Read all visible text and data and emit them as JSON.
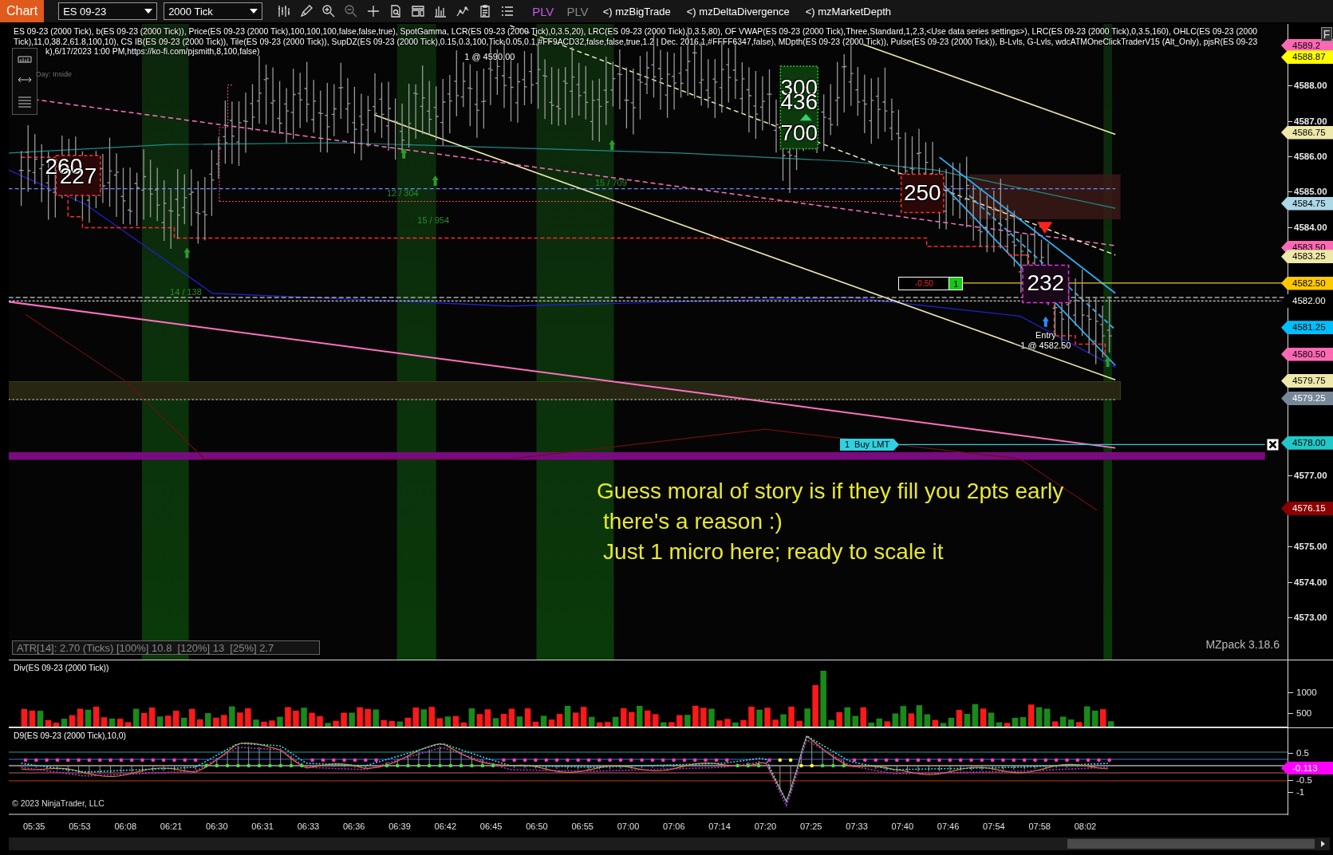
{
  "toolbar": {
    "title": "Chart",
    "instrument": "ES 09-23",
    "period": "2000 Tick",
    "buttons": [
      {
        "label": "PLV",
        "on": true
      },
      {
        "label": "PLV",
        "on": false
      }
    ],
    "indicators": [
      "<) mzBigTrade",
      "<) mzDeltaDivergence",
      "<) mzMarketDepth"
    ]
  },
  "legend": [
    "ES 09-23 (2000 Tick), b(ES 09-23 (2000 Tick)), Price(ES 09-23 (2000 Tick),100,100,100,false,false,true), SpotGamma, LCR(ES 09-23 (2000 Tick),0,3.5,20), LRC(ES 09-23 (2000 Tick),0,3.5,80), OF VWAP(ES 09-23 (2000 Tick),Three,Standard,1,2,3,<Use data series settings>), LRC(ES 09-23 (2000 Tick),0,3.5,160), OHLC(ES 09-23 (2000",
    "Tick),11,0,38.2,61.8,100,10), CS IB(ES 09-23 (2000 Tick)), Tile(ES 09-23 (2000 Tick)), SupDZ(ES 09-23 (2000 Tick),0.15,0.3,100,Tick,0.05,0.1,#FF9ACD32,false,false,true,1.2 | Dec. 2016,1,#FFFF6347,false), MDpth(ES 09-23 (2000 Tick)), Pulse(ES 09-23 (2000 Tick)), B-Lvls, G-Lvls, wdcATMOneClickTraderV15 (Alt_Only), pjsR(ES 09-23",
    "k),6/17/2023 1:00 PM,https://ko-fi.com/pjsmith,8,100,false)"
  ],
  "day_label": "Day: Inside",
  "cluster_labels": [
    "260",
    "227",
    "300",
    "436",
    "700",
    "250",
    "232"
  ],
  "delta_labels": [
    "12 / 304",
    "15 / 954",
    "15 / 709",
    "14 / 138"
  ],
  "target": {
    "fill": "1 @ 4590.00"
  },
  "entry": {
    "label": "Entry",
    "fill": "1 @ 4582.50"
  },
  "position": {
    "pnl": "-0.50",
    "quantity": "1"
  },
  "order": {
    "label": "1  Buy LMT"
  },
  "note": [
    "Guess moral of story is if they fill you 2pts early",
    "there's a reason :)",
    "Just 1 micro here; ready to scale it"
  ],
  "atr": "ATR[14]: 2.70 (Ticks) [100%] 10.8  [120%] 13  [25%] 2.7",
  "version": "MZpack 3.18.6",
  "price_axis": {
    "button": "F",
    "ticks": [
      "4588.00",
      "4587.00",
      "4586.00",
      "4585.00",
      "4584.00",
      "4577.00",
      "4575.00",
      "4574.00",
      "4573.00"
    ],
    "markers": [
      {
        "value": "4589.2",
        "color": "#ff69b4"
      },
      {
        "value": "4588.87",
        "color": "#ffff00"
      },
      {
        "value": "4586.75",
        "color": "#eee8aa"
      },
      {
        "value": "4584.75",
        "color": "#add8e6"
      },
      {
        "value": "4583.50",
        "color": "#ff69b4"
      },
      {
        "value": "4583.25",
        "color": "#eee8aa"
      },
      {
        "value": "4582.50",
        "color": "#ffc800"
      },
      {
        "value": "4582.00",
        "color": "#000000"
      },
      {
        "value": "4581.25",
        "color": "#00bfff"
      },
      {
        "value": "4580.50",
        "color": "#ff69b4"
      },
      {
        "value": "4579.75",
        "color": "#eee8aa"
      },
      {
        "value": "4579.25",
        "color": "#778899"
      },
      {
        "value": "4578.00",
        "color": "#20c8c8"
      },
      {
        "value": "4576.15",
        "color": "#8b0000"
      }
    ]
  },
  "div_panel": {
    "title": "Div(ES 09-23 (2000 Tick))",
    "axis_labels": [
      "1000",
      "500"
    ]
  },
  "d9_panel": {
    "title": "D9(ES 09-23 (2000 Tick),10,0)",
    "axis_labels": [
      "0.5",
      "-0.5",
      "-1"
    ],
    "marker": {
      "value": "-0.113",
      "color": "#ff00ff"
    }
  },
  "copyright": "© 2023 NinjaTrader, LLC",
  "time_axis": [
    "05:35",
    "05:53",
    "06:08",
    "06:21",
    "06:30",
    "06:31",
    "06:33",
    "06:36",
    "06:39",
    "06:42",
    "06:45",
    "06:50",
    "06:55",
    "07:00",
    "07:06",
    "07:14",
    "07:20",
    "07:25",
    "07:33",
    "07:40",
    "07:46",
    "07:54",
    "07:58",
    "08:02"
  ]
}
